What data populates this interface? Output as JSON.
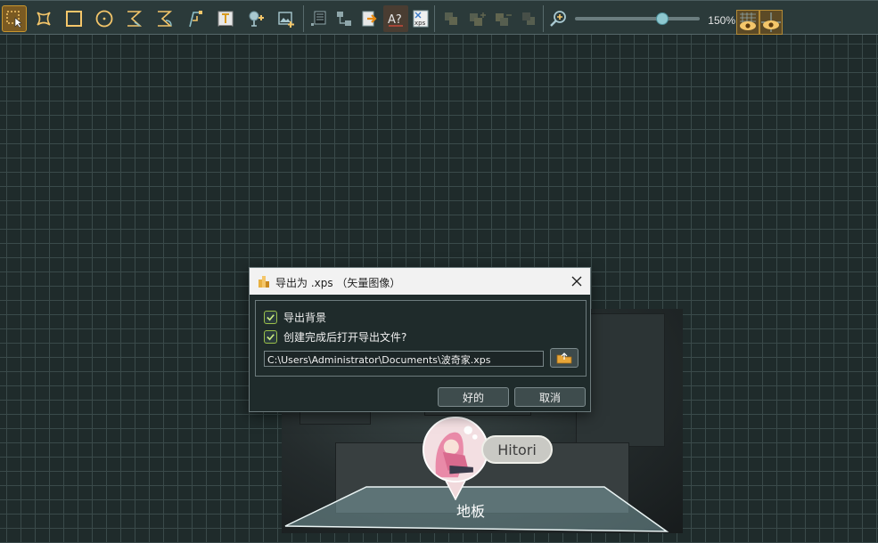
{
  "toolbar": {
    "tools": [
      {
        "icon": "select-tool-icon",
        "active": true
      },
      {
        "icon": "polygon-tool-icon"
      },
      {
        "icon": "rectangle-tool-icon"
      },
      {
        "icon": "circle-tool-icon"
      },
      {
        "icon": "bezier-tool-icon"
      },
      {
        "icon": "curve-tool-icon"
      },
      {
        "icon": "path-tool-icon"
      },
      {
        "icon": "text-tool-icon"
      },
      {
        "icon": "node-tool-icon"
      },
      {
        "icon": "image-tool-icon"
      }
    ],
    "actions": [
      {
        "icon": "grid-list-icon"
      },
      {
        "icon": "connect-icon"
      },
      {
        "icon": "export-icon"
      },
      {
        "icon": "text-style-icon",
        "label": "A?"
      },
      {
        "icon": "xps-export-icon",
        "label": "xps"
      }
    ],
    "arrange": [
      {
        "icon": "bring-front-icon"
      },
      {
        "icon": "bring-forward-icon"
      },
      {
        "icon": "send-backward-icon"
      },
      {
        "icon": "send-back-icon"
      }
    ],
    "zoom": {
      "label": "150%",
      "level": 0.7
    }
  },
  "scene": {
    "floor_label": "地板",
    "character_name": "Hitori"
  },
  "dialog": {
    "title": "导出为 .xps （矢量图像）",
    "export_background": {
      "label": "导出背景",
      "checked": true
    },
    "open_after": {
      "label": "创建完成后打开导出文件?",
      "checked": true
    },
    "path": "C:\\Users\\Administrator\\Documents\\波奇家.xps",
    "ok_label": "好的",
    "cancel_label": "取消"
  },
  "colors": {
    "canvas": "#1f2b2b",
    "grid": "#3a4a4a",
    "accent": "#c9962e",
    "check": "#9bc04a"
  }
}
